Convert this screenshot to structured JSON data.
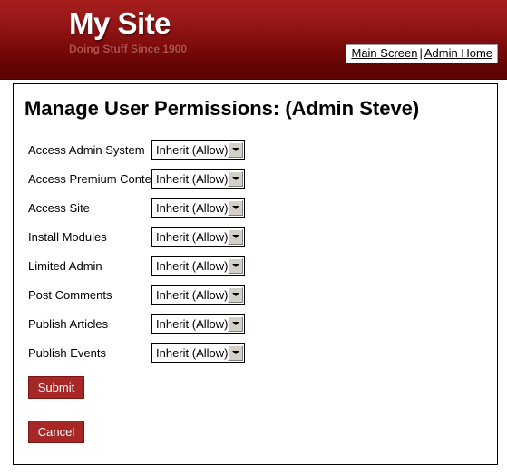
{
  "header": {
    "site_title": "My Site",
    "tagline": "Doing Stuff Since 1900",
    "nav": {
      "main_screen": "Main Screen",
      "separator": "|",
      "admin_home": "Admin Home"
    },
    "colors": {
      "gradient_top": "#a61d1d",
      "gradient_bottom": "#5c0202",
      "tagline_text": "#b5514c",
      "title_text": "#ffffff"
    }
  },
  "main": {
    "page_title": "Manage User Permissions: (Admin Steve)",
    "permissions": [
      {
        "label": "Access Admin System",
        "value": "Inherit (Allow)"
      },
      {
        "label": "Access Premium Content",
        "value": "Inherit (Allow)"
      },
      {
        "label": "Access Site",
        "value": "Inherit (Allow)"
      },
      {
        "label": "Install Modules",
        "value": "Inherit (Allow)"
      },
      {
        "label": "Limited Admin",
        "value": "Inherit (Allow)"
      },
      {
        "label": "Post Comments",
        "value": "Inherit (Allow)"
      },
      {
        "label": "Publish Articles",
        "value": "Inherit (Allow)"
      },
      {
        "label": "Publish Events",
        "value": "Inherit (Allow)"
      }
    ],
    "buttons": {
      "submit": "Submit",
      "cancel": "Cancel"
    },
    "button_color": "#a72626"
  }
}
